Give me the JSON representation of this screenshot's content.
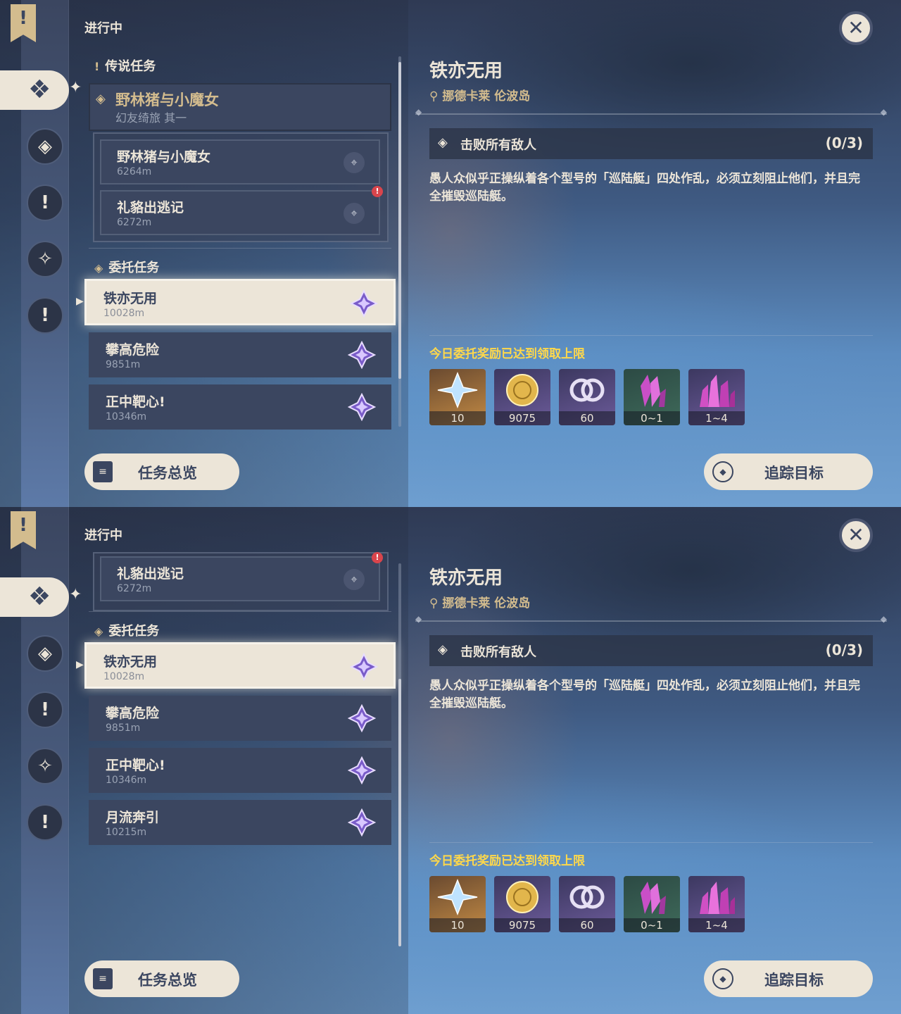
{
  "panels": [
    {
      "status_label": "进行中",
      "legend_section": "传说任务",
      "legend_quest": {
        "title": "野林猪与小魔女",
        "subtitle": "幻友绮旅 其一"
      },
      "sub_quests": [
        {
          "name": "野林猪与小魔女",
          "distance": "6264m",
          "alert": false
        },
        {
          "name": "礼貉出逃记",
          "distance": "6272m",
          "alert": true
        }
      ],
      "commission_section": "委托任务",
      "commissions": [
        {
          "name": "铁亦无用",
          "distance": "10028m",
          "selected": true
        },
        {
          "name": "攀高危险",
          "distance": "9851m",
          "selected": false
        },
        {
          "name": "正中靶心!",
          "distance": "10346m",
          "selected": false
        }
      ],
      "overview_button": "任务总览",
      "detail": {
        "title": "铁亦无用",
        "location": "挪德卡莱 伦波岛",
        "objective": "击败所有敌人",
        "objective_count": "(0/3)",
        "description": "愚人众似乎正操纵着各个型号的「巡陆艇」四处作乱，必须立刻阻止他们，并且完全摧毁巡陆艇。",
        "reward_note": "今日委托奖励已达到领取上限",
        "rewards": [
          {
            "icon": "primogem-icon",
            "qty": "10",
            "bg": "orange"
          },
          {
            "icon": "mora-coin-icon",
            "qty": "9075",
            "bg": "purple"
          },
          {
            "icon": "companionship-exp-icon",
            "qty": "60",
            "bg": "purple"
          },
          {
            "icon": "crystal-green-icon",
            "qty": "0~1",
            "bg": "green"
          },
          {
            "icon": "crystal-cluster-icon",
            "qty": "1~4",
            "bg": "purple"
          }
        ],
        "track_button": "追踪目标"
      }
    },
    {
      "status_label": "进行中",
      "sub_quests": [
        {
          "name": "礼貉出逃记",
          "distance": "6272m",
          "alert": true
        }
      ],
      "commission_section": "委托任务",
      "commissions": [
        {
          "name": "铁亦无用",
          "distance": "10028m",
          "selected": true
        },
        {
          "name": "攀高危险",
          "distance": "9851m",
          "selected": false
        },
        {
          "name": "正中靶心!",
          "distance": "10346m",
          "selected": false
        },
        {
          "name": "月流奔引",
          "distance": "10215m",
          "selected": false
        }
      ],
      "overview_button": "任务总览",
      "detail": {
        "title": "铁亦无用",
        "location": "挪德卡莱 伦波岛",
        "objective": "击败所有敌人",
        "objective_count": "(0/3)",
        "description": "愚人众似乎正操纵着各个型号的「巡陆艇」四处作乱，必须立刻阻止他们，并且完全摧毁巡陆艇。",
        "reward_note": "今日委托奖励已达到领取上限",
        "rewards": [
          {
            "icon": "primogem-icon",
            "qty": "10",
            "bg": "orange"
          },
          {
            "icon": "mora-coin-icon",
            "qty": "9075",
            "bg": "purple"
          },
          {
            "icon": "companionship-exp-icon",
            "qty": "60",
            "bg": "purple"
          },
          {
            "icon": "crystal-green-icon",
            "qty": "0~1",
            "bg": "green"
          },
          {
            "icon": "crystal-cluster-icon",
            "qty": "1~4",
            "bg": "purple"
          }
        ],
        "track_button": "追踪目标"
      }
    }
  ]
}
